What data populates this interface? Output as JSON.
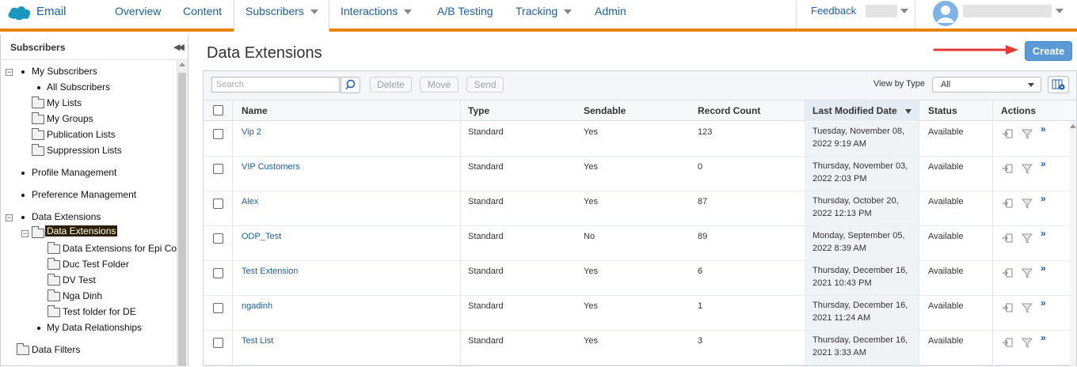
{
  "app": {
    "name": "Email",
    "logo_icon": "salesforce-cloud-icon"
  },
  "nav": {
    "items": [
      "Overview",
      "Content",
      "Subscribers",
      "Interactions",
      "A/B Testing",
      "Tracking",
      "Admin"
    ],
    "active": "Subscribers",
    "feedback": "Feedback"
  },
  "sidebar": {
    "title": "Subscribers",
    "tree": {
      "my_subscribers": "My Subscribers",
      "all_subscribers": "All Subscribers",
      "my_lists": "My Lists",
      "my_groups": "My Groups",
      "publication_lists": "Publication Lists",
      "suppression_lists": "Suppression Lists",
      "profile_management": "Profile Management",
      "preference_management": "Preference Management",
      "data_extensions_root": "Data Extensions",
      "data_extensions_folder": "Data Extensions",
      "folders": [
        "Data Extensions for Epi Co",
        "Duc Test Folder",
        "DV Test",
        "Nga Dinh",
        "Test folder for DE"
      ],
      "my_data_relationships": "My Data Relationships",
      "data_filters": "Data Filters"
    }
  },
  "main": {
    "title": "Data Extensions",
    "create_label": "Create",
    "toolbar": {
      "search_placeholder": "Search",
      "delete": "Delete",
      "move": "Move",
      "send": "Send",
      "view_by_label": "View by Type",
      "view_by_value": "All"
    },
    "columns": {
      "name": "Name",
      "type": "Type",
      "sendable": "Sendable",
      "record_count": "Record Count",
      "last_modified": "Last Modified Date",
      "status": "Status",
      "actions": "Actions"
    },
    "rows": [
      {
        "name": "Vip 2",
        "type": "Standard",
        "sendable": "Yes",
        "count": "123",
        "mod1": "Tuesday, November 08,",
        "mod2": "2022 9:19 AM",
        "status": "Available"
      },
      {
        "name": "VIP Customers",
        "type": "Standard",
        "sendable": "Yes",
        "count": "0",
        "mod1": "Thursday, November 03,",
        "mod2": "2022 2:03 PM",
        "status": "Available"
      },
      {
        "name": "Alex",
        "type": "Standard",
        "sendable": "Yes",
        "count": "87",
        "mod1": "Thursday, October 20,",
        "mod2": "2022 12:13 PM",
        "status": "Available"
      },
      {
        "name": "ODP_Test",
        "type": "Standard",
        "sendable": "No",
        "count": "89",
        "mod1": "Monday, September 05,",
        "mod2": "2022 8:39 AM",
        "status": "Available"
      },
      {
        "name": "Test Extension",
        "type": "Standard",
        "sendable": "Yes",
        "count": "6",
        "mod1": "Thursday, December 16,",
        "mod2": "2021 10:43 PM",
        "status": "Available"
      },
      {
        "name": "ngadinh",
        "type": "Standard",
        "sendable": "Yes",
        "count": "1",
        "mod1": "Thursday, December 16,",
        "mod2": "2021 11:24 AM",
        "status": "Available"
      },
      {
        "name": "Test List",
        "type": "Standard",
        "sendable": "Yes",
        "count": "3",
        "mod1": "Thursday, December 16,",
        "mod2": "2021 3:33 AM",
        "status": "Available"
      }
    ]
  },
  "colors": {
    "accent": "#e8850c",
    "link": "#1b5fa8",
    "create": "#5a9ad6",
    "annotation_arrow": "#e53935"
  }
}
